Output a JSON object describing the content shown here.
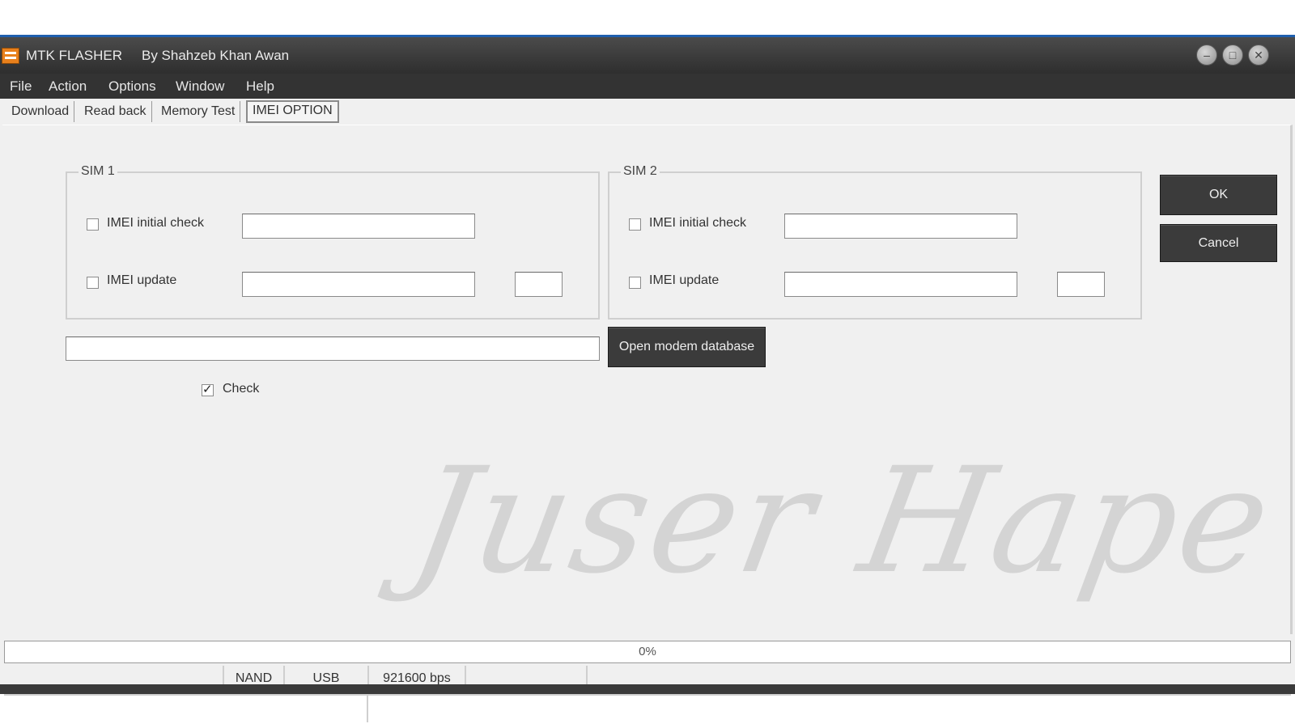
{
  "window": {
    "app_title": "MTK FLASHER",
    "author": "By Shahzeb Khan Awan",
    "controls": [
      "minimize-icon",
      "maximize-icon",
      "close-icon"
    ]
  },
  "menu": [
    "File",
    "Action",
    "Options",
    "Window",
    "Help"
  ],
  "tabs": [
    {
      "label": "Download",
      "active": false
    },
    {
      "label": "Read back",
      "active": false
    },
    {
      "label": "Memory Test",
      "active": false
    },
    {
      "label": "IMEI OPTION",
      "active": true
    }
  ],
  "sim1": {
    "title": "SIM 1",
    "initial_check_label": "IMEI initial check",
    "initial_check_checked": false,
    "initial_check_value": "",
    "update_label": "IMEI update",
    "update_checked": false,
    "update_value": "",
    "update_extra_value": ""
  },
  "sim2": {
    "title": "SIM 2",
    "initial_check_label": "IMEI initial check",
    "initial_check_checked": false,
    "initial_check_value": "",
    "update_label": "IMEI update",
    "update_checked": false,
    "update_value": "",
    "update_extra_value": ""
  },
  "database": {
    "path_value": "",
    "open_button": "Open modem database",
    "check_label": "Check",
    "check_checked": true
  },
  "actions": {
    "ok": "OK",
    "cancel": "Cancel"
  },
  "watermark": "Juser Hape",
  "progress": {
    "text": "0%",
    "value": 0
  },
  "status": {
    "storage": "NAND",
    "connection": "USB",
    "baud": "921600 bps"
  }
}
